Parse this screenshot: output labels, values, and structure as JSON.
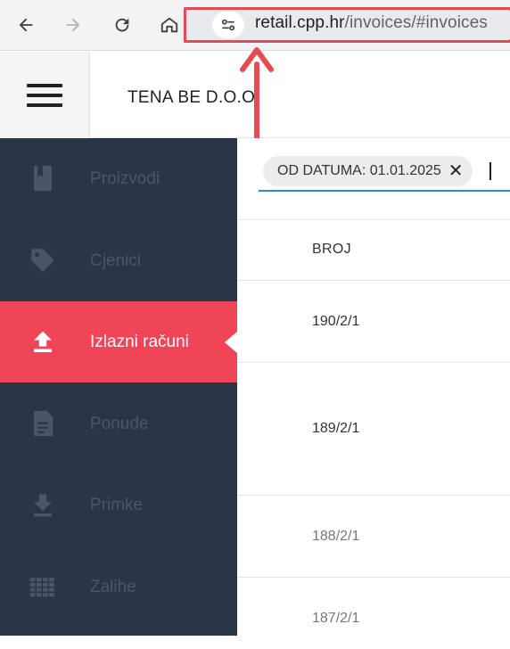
{
  "browser": {
    "url_host": "retail.cpp.hr",
    "url_path": "/invoices/#invoices"
  },
  "header": {
    "company_name": "TENA BE D.O.O."
  },
  "sidebar": {
    "items": [
      {
        "label": "Proizvodi",
        "icon": "book-icon"
      },
      {
        "label": "Cjenici",
        "icon": "tag-icon"
      },
      {
        "label": "Izlazni računi",
        "icon": "upload-icon",
        "active": true
      },
      {
        "label": "Ponude",
        "icon": "document-icon"
      },
      {
        "label": "Primke",
        "icon": "download-icon"
      },
      {
        "label": "Zalihe",
        "icon": "grid-icon"
      }
    ]
  },
  "filter": {
    "chip_label": "OD DATUMA: 01.01.2025"
  },
  "table": {
    "columns": [
      "BROJ"
    ],
    "rows": [
      {
        "broj": "190/2/1"
      },
      {
        "broj": "189/2/1"
      },
      {
        "broj": "188/2/1"
      },
      {
        "broj": "187/2/1"
      }
    ]
  },
  "colors": {
    "sidebar_bg": "#2a3648",
    "active_bg": "#f04457",
    "annotation": "#e84a52",
    "accent": "#2a8ad4"
  }
}
